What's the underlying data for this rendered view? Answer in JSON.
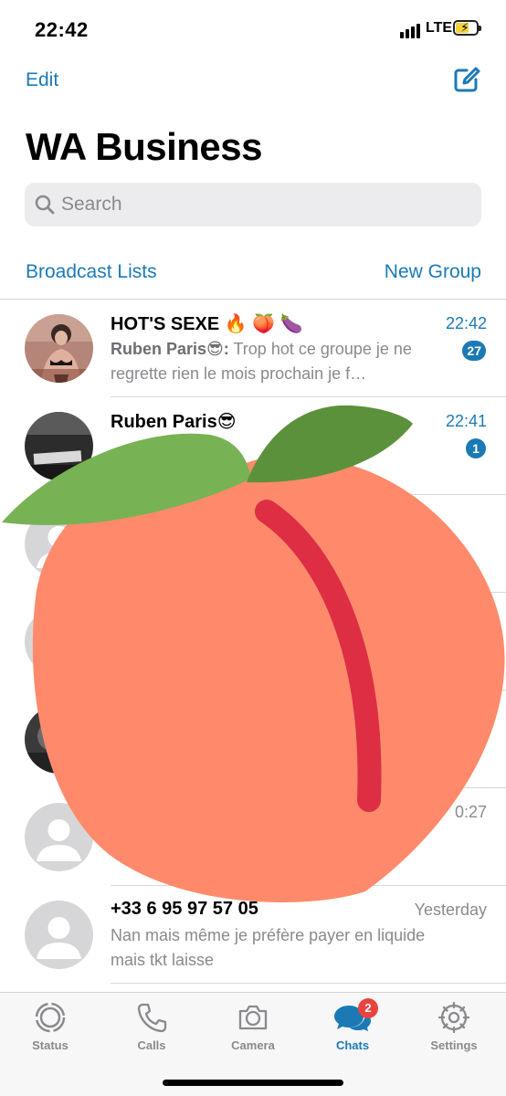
{
  "status_bar": {
    "time": "22:42",
    "network": "LTE"
  },
  "header": {
    "edit_label": "Edit",
    "title": "WA Business"
  },
  "search": {
    "placeholder": "Search"
  },
  "links": {
    "broadcast": "Broadcast Lists",
    "new_group": "New Group"
  },
  "chats": [
    {
      "name": "HOT'S SEXE 🔥 🍑 🍆",
      "time": "22:42",
      "sender": "Ruben Paris😎:",
      "preview": " Trop hot ce groupe je ne regrette rien le mois prochain je f…",
      "unread": "27"
    },
    {
      "name": "Ruben Paris😎",
      "time": "22:41",
      "sender": "",
      "preview": "",
      "unread": "1"
    },
    {
      "name": "",
      "time": "",
      "sender": "",
      "preview": "",
      "unread": ""
    },
    {
      "name": "",
      "time": "",
      "sender": "",
      "preview": "",
      "unread": ""
    },
    {
      "name": "",
      "time": "",
      "sender": "",
      "preview": "",
      "unread": ""
    },
    {
      "name": "",
      "time": "0:27",
      "sender": "",
      "preview": "",
      "unread": ""
    },
    {
      "name": "+33 6 95 97 57 05",
      "time": "Yesterday",
      "sender": "",
      "preview": "Nan mais même je préfère payer en liquide mais tkt laisse",
      "unread": ""
    }
  ],
  "tab_bar": {
    "tabs": [
      {
        "label": "Status",
        "icon": "status-icon"
      },
      {
        "label": "Calls",
        "icon": "phone-icon"
      },
      {
        "label": "Camera",
        "icon": "camera-icon"
      },
      {
        "label": "Chats",
        "icon": "chats-icon",
        "badge": "2"
      },
      {
        "label": "Settings",
        "icon": "gear-icon"
      }
    ]
  },
  "overlay": {
    "icon": "peach-emoji"
  },
  "colors": {
    "accent": "#1b7ab5",
    "badge_red": "#e9433f",
    "peach": "#ff8a6b",
    "leaf": "#77b255"
  }
}
